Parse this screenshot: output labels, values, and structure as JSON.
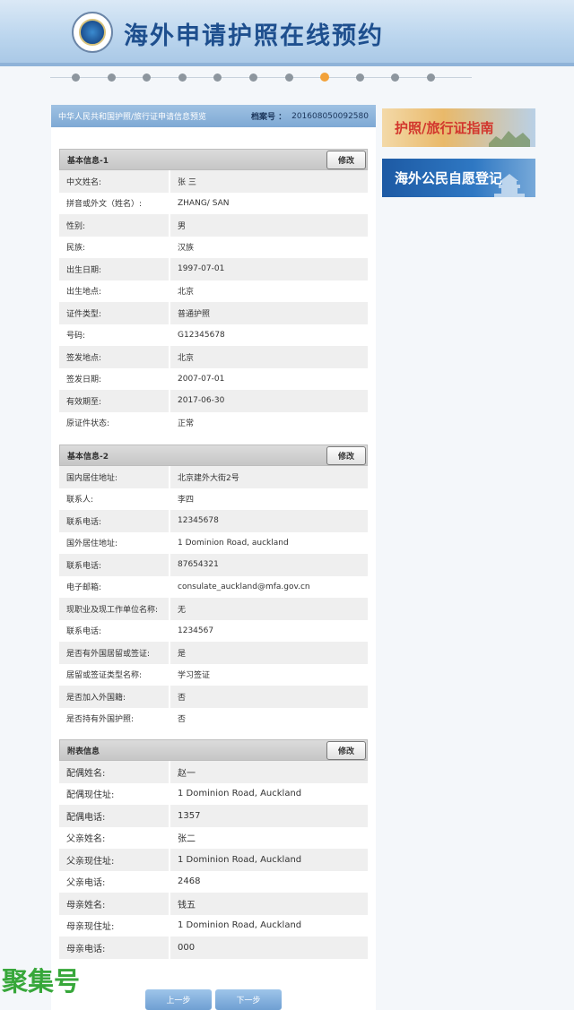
{
  "header": {
    "site_title": "海外申请护照在线预约"
  },
  "progress": {
    "steps": 11,
    "active_step": 8
  },
  "panel": {
    "title": "中华人民共和国护照/旅行证申请信息预览",
    "file_label": "档案号 ：",
    "file_no": "201608050092580"
  },
  "sections": {
    "basic1": {
      "title": "基本信息-1",
      "edit_label": "修改",
      "rows": [
        {
          "label": "中文姓名:",
          "value": "张 三"
        },
        {
          "label": "拼音或外文（姓名）:",
          "value": "ZHANG/ SAN"
        },
        {
          "label": "性别:",
          "value": "男"
        },
        {
          "label": "民族:",
          "value": "汉族"
        },
        {
          "label": "出生日期:",
          "value": "1997-07-01"
        },
        {
          "label": "出生地点:",
          "value": "北京"
        },
        {
          "label": "证件类型:",
          "value": "普通护照"
        },
        {
          "label": "号码:",
          "value": "G12345678"
        },
        {
          "label": "签发地点:",
          "value": "北京"
        },
        {
          "label": "签发日期:",
          "value": "2007-07-01"
        },
        {
          "label": "有效期至:",
          "value": "2017-06-30"
        },
        {
          "label": "原证件状态:",
          "value": "正常"
        }
      ]
    },
    "basic2": {
      "title": "基本信息-2",
      "edit_label": "修改",
      "rows": [
        {
          "label": "国内居住地址:",
          "value": "北京建外大街2号"
        },
        {
          "label": "联系人:",
          "value": "李四"
        },
        {
          "label": "联系电话:",
          "value": "12345678"
        },
        {
          "label": "国外居住地址:",
          "value": "1 Dominion Road, auckland"
        },
        {
          "label": "联系电话:",
          "value": "87654321"
        },
        {
          "label": "电子邮箱:",
          "value": "consulate_auckland@mfa.gov.cn"
        },
        {
          "label": "现职业及现工作单位名称:",
          "value": "无"
        },
        {
          "label": "联系电话:",
          "value": "1234567"
        },
        {
          "label": "是否有外国居留或签证:",
          "value": "是"
        },
        {
          "label": "居留或签证类型名称:",
          "value": "学习签证"
        },
        {
          "label": "是否加入外国籍:",
          "value": "否"
        },
        {
          "label": "是否持有外国护照:",
          "value": "否"
        }
      ]
    },
    "attached": {
      "title": "附表信息",
      "edit_label": "修改",
      "rows": [
        {
          "label": "配偶姓名:",
          "value": "赵一"
        },
        {
          "label": "配偶现住址:",
          "value": "1 Dominion Road, Auckland"
        },
        {
          "label": "配偶电话:",
          "value": "1357"
        },
        {
          "label": "父亲姓名:",
          "value": "张二"
        },
        {
          "label": "父亲现住址:",
          "value": "1 Dominion Road, Auckland"
        },
        {
          "label": "父亲电话:",
          "value": "2468"
        },
        {
          "label": "母亲姓名:",
          "value": "钱五"
        },
        {
          "label": "母亲现住址:",
          "value": "1 Dominion Road, Auckland"
        },
        {
          "label": "母亲电话:",
          "value": "000"
        }
      ]
    }
  },
  "buttons": {
    "prev": "上一步",
    "next": "下一步"
  },
  "banners": {
    "guide": "护照/旅行证指南",
    "register": "海外公民自愿登记"
  },
  "watermark": "聚集号",
  "colors": {
    "accent": "#f2a23a",
    "header_blue": "#1e4f8e",
    "banner_red": "#d2362d",
    "watermark_green": "#37a73a"
  }
}
